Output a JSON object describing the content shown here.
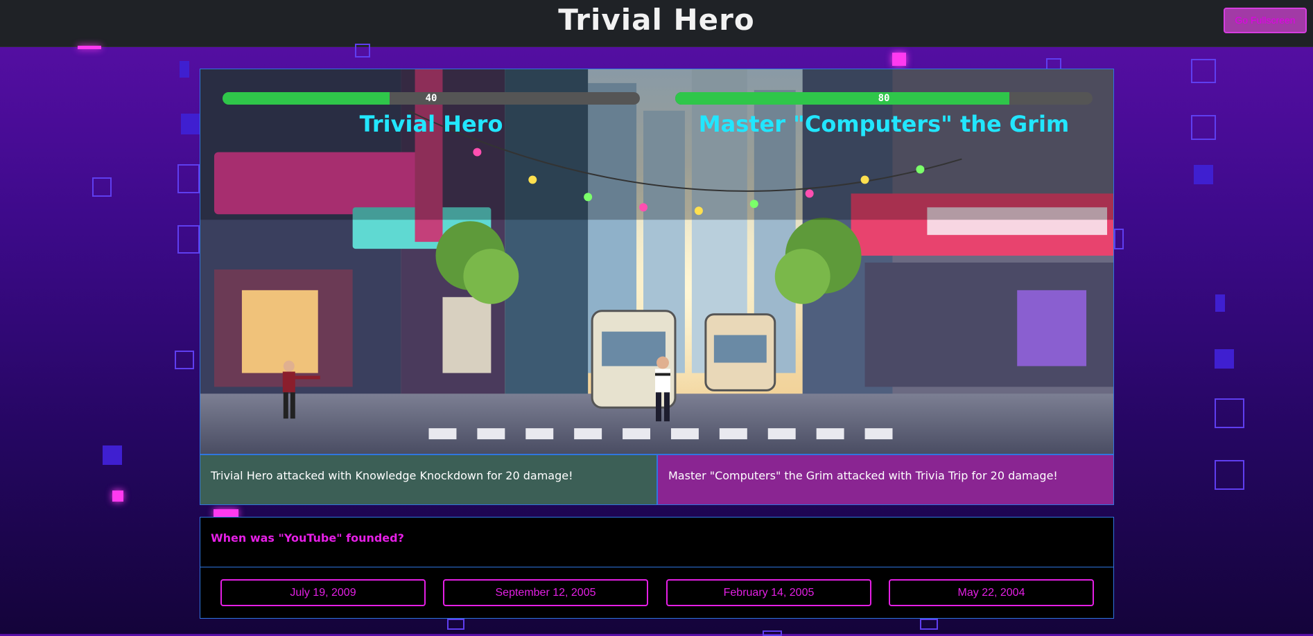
{
  "header": {
    "title": "Trivial Hero",
    "fullscreen_label": "Go Fullscreen"
  },
  "colors": {
    "accent": "#e51fe5",
    "name": "#22e6ff",
    "hp": "#2fc64a",
    "border": "#2f76e0"
  },
  "player": {
    "name": "Trivial Hero",
    "hp": 40,
    "hp_max": 100
  },
  "enemy": {
    "name": "Master \"Computers\" the Grim",
    "hp": 80,
    "hp_max": 100
  },
  "log": {
    "player": "Trivial Hero attacked with Knowledge Knockdown for 20 damage!",
    "enemy": "Master \"Computers\" the Grim attacked with Trivia Trip for 20 damage!"
  },
  "question": "When was \"YouTube\" founded?",
  "answers": [
    "July 19, 2009",
    "September 12, 2005",
    "February 14, 2005",
    "May 22, 2004"
  ]
}
